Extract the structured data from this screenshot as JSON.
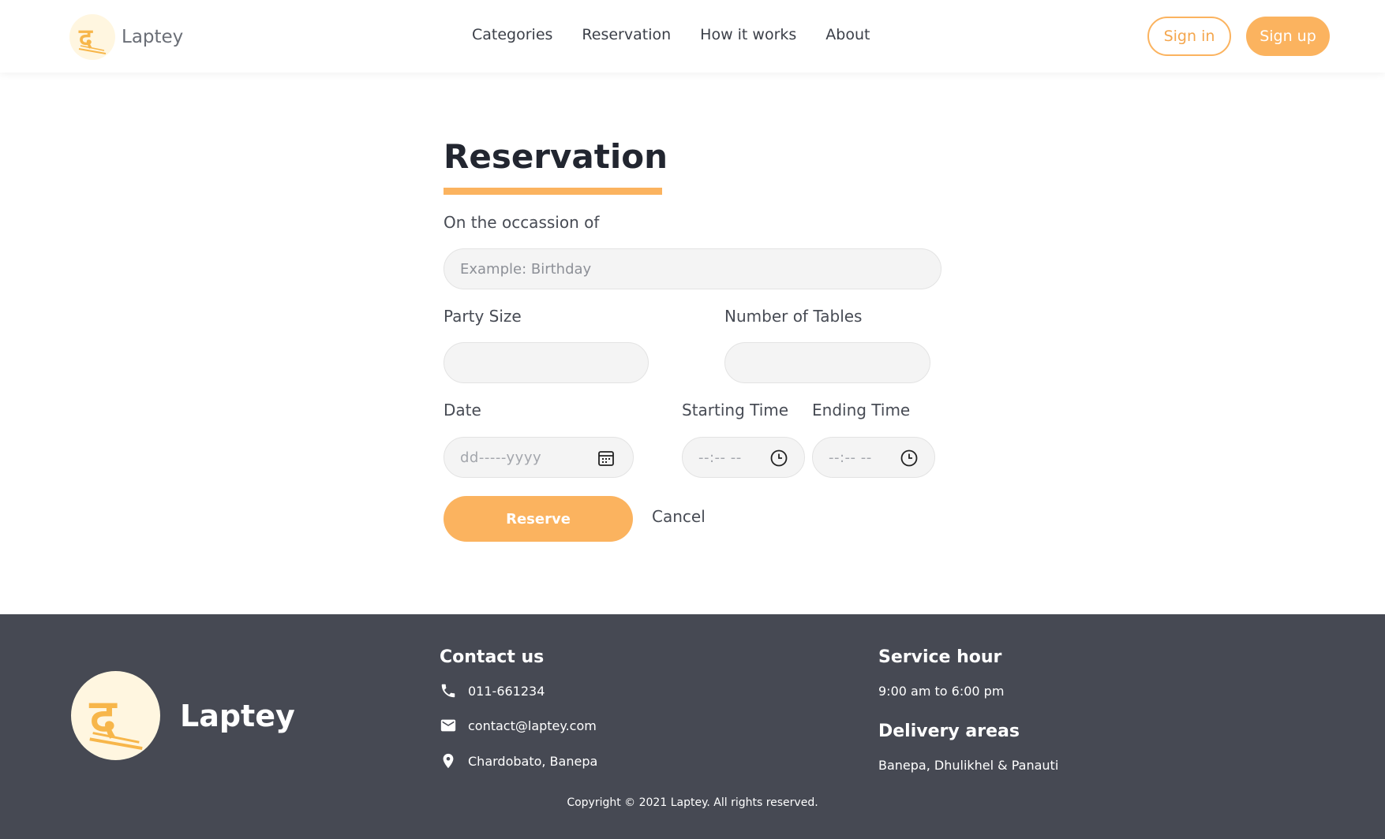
{
  "header": {
    "brand": "Laptey",
    "nav": [
      "Categories",
      "Reservation",
      "How it works",
      "About"
    ],
    "signin_label": "Sign in",
    "signup_label": "Sign up"
  },
  "form": {
    "title": "Reservation",
    "occasion_label": "On the occassion of",
    "occasion_placeholder": "Example: Birthday",
    "party_size_label": "Party Size",
    "party_size_value": "",
    "tables_label": "Number of Tables",
    "tables_value": "",
    "date_label": "Date",
    "date_placeholder": "dd-----yyyy",
    "start_time_label": "Starting Time",
    "start_time_placeholder": "--:-- --",
    "end_time_label": "Ending Time",
    "end_time_placeholder": "--:-- --",
    "reserve_label": "Reserve",
    "cancel_label": "Cancel"
  },
  "footer": {
    "brand": "Laptey",
    "contact_heading": "Contact us",
    "phone": "011-661234",
    "email": "contact@laptey.com",
    "address": "Chardobato, Banepa",
    "service_heading": "Service hour",
    "service_hours": "9:00 am to 6:00 pm",
    "delivery_heading": "Delivery areas",
    "delivery_areas": "Banepa, Dhulikhel & Panauti",
    "copyright": "Copyright © 2021 Laptey. All rights reserved."
  },
  "colors": {
    "accent": "#fbb35f",
    "footer_bg": "#464953",
    "logo_bg": "#fff6e0"
  },
  "icons": {
    "logo": "laptey-logo-icon",
    "phone": "phone-icon",
    "email": "mail-icon",
    "address": "location-pin-icon",
    "date": "calendar-icon",
    "time": "clock-icon"
  }
}
